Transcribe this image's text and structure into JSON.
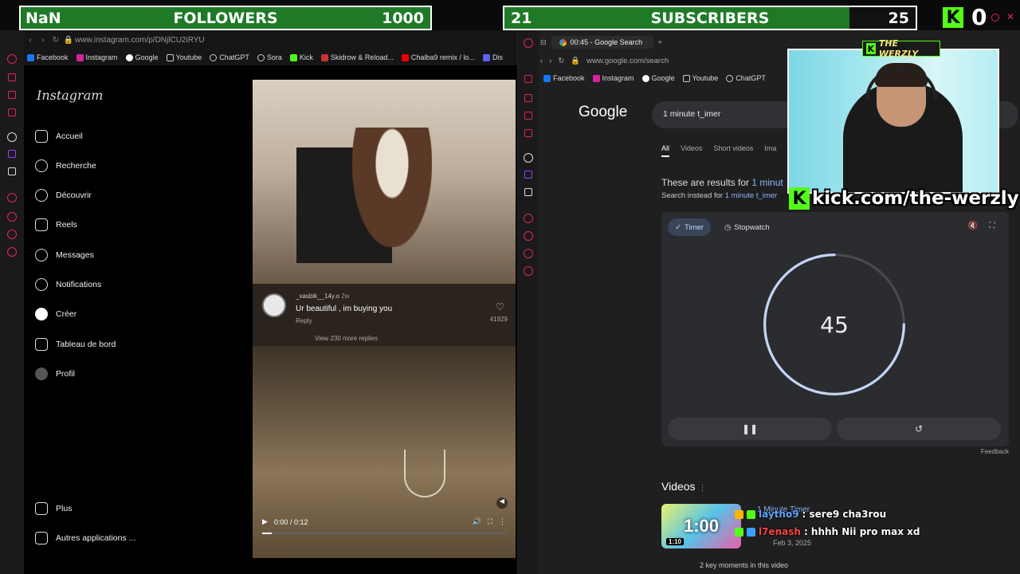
{
  "overlay": {
    "followers": {
      "left": "NaN",
      "label": "FOLLOWERS",
      "goal": "1000"
    },
    "subscribers": {
      "left": "21",
      "label": "SUBSCRIBERS",
      "goal": "25"
    },
    "kick_count": "0",
    "cam_badge": "THE WERZLY",
    "kick_url": "kick.com/the-werzly"
  },
  "left_browser": {
    "url": "www.instagram.com/p/DNjlCU2iRYU",
    "bookmarks": [
      "Facebook",
      "Instagram",
      "Google",
      "Youtube",
      "ChatGPT",
      "Sora",
      "Kick",
      "Skidrow & Reload...",
      "Chalba9 remix / lo...",
      "Dis"
    ],
    "instagram": {
      "logo": "Instagram",
      "nav": [
        "Accueil",
        "Recherche",
        "Découvrir",
        "Reels",
        "Messages",
        "Notifications",
        "Créer",
        "Tableau de bord",
        "Profil"
      ],
      "bottom_nav": [
        "Plus",
        "Autres applications ..."
      ],
      "comment": {
        "user": "_xasbik__14y.o",
        "age": "2w",
        "text": "Ur beautiful , im buying you",
        "reply": "Reply",
        "likes": "41929",
        "more_replies": "View 230 more replies"
      },
      "video_time": "0:00 / 0:12",
      "progress": 0.04
    }
  },
  "right_browser": {
    "tab_title": "00:45 - Google Search",
    "url": "www.google.com/search",
    "bookmarks": [
      "Facebook",
      "Instagram",
      "Google",
      "Youtube",
      "ChatGPT"
    ],
    "google": {
      "logo": "Google",
      "query": "1 minute t_imer",
      "tabs": [
        "All",
        "Videos",
        "Short videos",
        "Ima"
      ],
      "results_for_prefix": "These are results for",
      "results_for_link": "1 minut",
      "search_instead_prefix": "Search instead for",
      "search_instead_link": "1 minute t_imer",
      "timer": {
        "mode_timer": "Timer",
        "mode_stopwatch": "Stopwatch",
        "value": "45",
        "remaining_fraction": 0.75,
        "pause_icon": "pause-icon",
        "reset_icon": "reset-icon"
      },
      "feedback": "Feedback",
      "videos_heading": "Videos",
      "video": {
        "thumb_text": "1:00",
        "duration": "1:10",
        "title": "1 Minute Timer",
        "date": "Feb 3, 2025",
        "key_moments": "2 key moments in this video"
      }
    }
  },
  "chat": [
    {
      "user": "laytho9",
      "message": ": sere9 cha3rou"
    },
    {
      "user": "l7enash",
      "message": ": hhhh Nii pro max xd"
    }
  ],
  "colors": {
    "kick_green": "#53fc18",
    "accent_red": "#e0245e",
    "google_link": "#8ab4f8"
  }
}
